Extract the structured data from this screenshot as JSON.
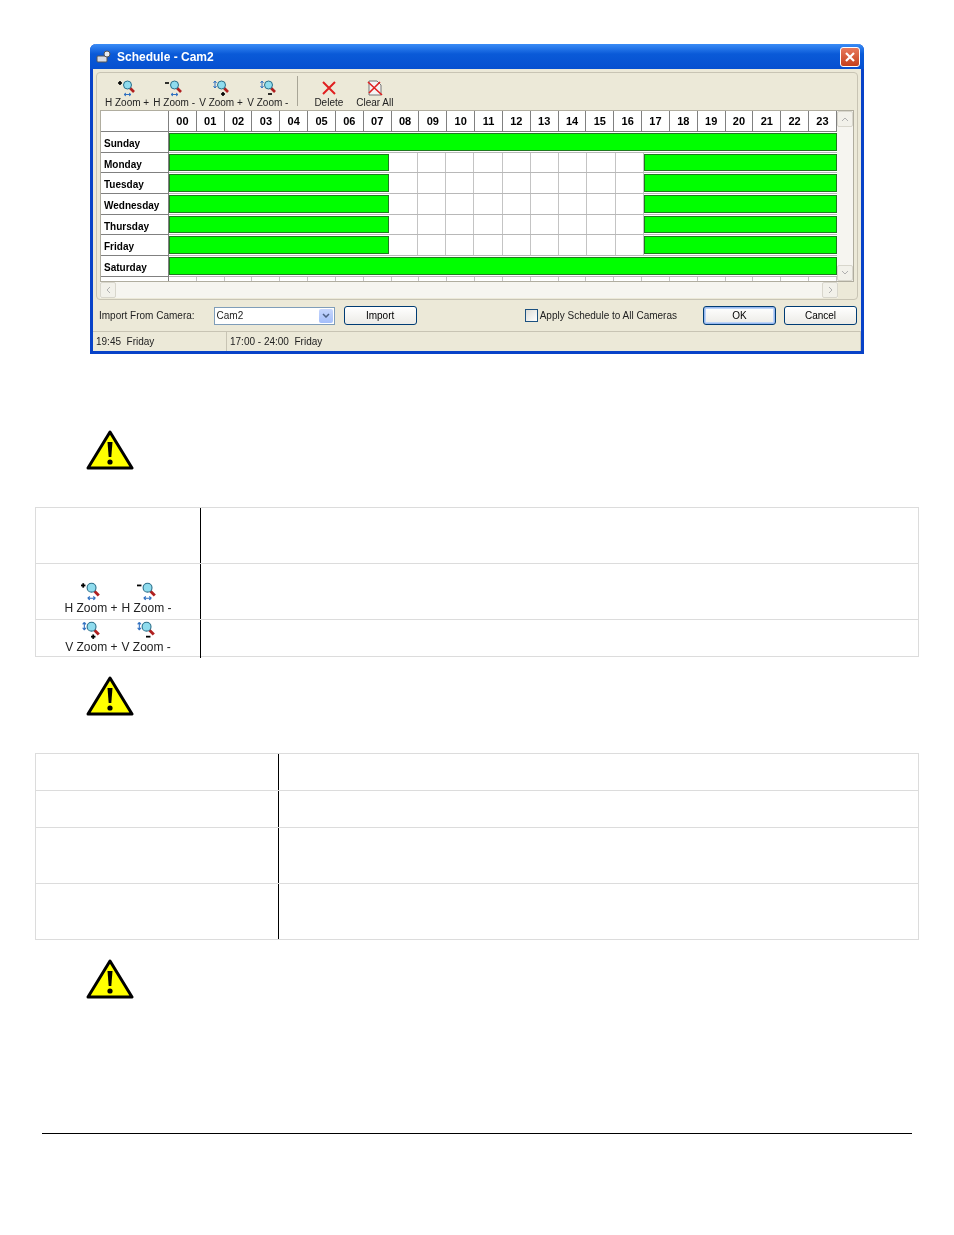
{
  "dialog": {
    "title": "Schedule - Cam2",
    "toolbar": [
      {
        "kind": "hzoom_in",
        "label": "H Zoom +",
        "separator_before": false
      },
      {
        "kind": "hzoom_out",
        "label": "H Zoom -",
        "separator_before": false
      },
      {
        "kind": "vzoom_in",
        "label": "V Zoom +",
        "separator_before": false
      },
      {
        "kind": "vzoom_out",
        "label": "V Zoom -",
        "separator_before": false
      },
      {
        "kind": "delete",
        "label": "Delete",
        "separator_before": true
      },
      {
        "kind": "clear",
        "label": "Clear All",
        "separator_before": false
      }
    ],
    "schedule": {
      "hours": [
        "00",
        "01",
        "02",
        "03",
        "04",
        "05",
        "06",
        "07",
        "08",
        "09",
        "10",
        "11",
        "12",
        "13",
        "14",
        "15",
        "16",
        "17",
        "18",
        "19",
        "20",
        "21",
        "22",
        "23"
      ],
      "days": [
        {
          "name": "Sunday",
          "scheduled": [
            true,
            true,
            true,
            true,
            true,
            true,
            true,
            true,
            true,
            true,
            true,
            true,
            true,
            true,
            true,
            true,
            true,
            true,
            true,
            true,
            true,
            true,
            true,
            true
          ]
        },
        {
          "name": "Monday",
          "scheduled": [
            true,
            true,
            true,
            true,
            true,
            true,
            true,
            true,
            false,
            false,
            false,
            false,
            false,
            false,
            false,
            false,
            false,
            true,
            true,
            true,
            true,
            true,
            true,
            true
          ]
        },
        {
          "name": "Tuesday",
          "scheduled": [
            true,
            true,
            true,
            true,
            true,
            true,
            true,
            true,
            false,
            false,
            false,
            false,
            false,
            false,
            false,
            false,
            false,
            true,
            true,
            true,
            true,
            true,
            true,
            true
          ]
        },
        {
          "name": "Wednesday",
          "scheduled": [
            true,
            true,
            true,
            true,
            true,
            true,
            true,
            true,
            false,
            false,
            false,
            false,
            false,
            false,
            false,
            false,
            false,
            true,
            true,
            true,
            true,
            true,
            true,
            true
          ]
        },
        {
          "name": "Thursday",
          "scheduled": [
            true,
            true,
            true,
            true,
            true,
            true,
            true,
            true,
            false,
            false,
            false,
            false,
            false,
            false,
            false,
            false,
            false,
            true,
            true,
            true,
            true,
            true,
            true,
            true
          ]
        },
        {
          "name": "Friday",
          "scheduled": [
            true,
            true,
            true,
            true,
            true,
            true,
            true,
            true,
            false,
            false,
            false,
            false,
            false,
            false,
            false,
            false,
            false,
            true,
            true,
            true,
            true,
            true,
            true,
            true
          ]
        },
        {
          "name": "Saturday",
          "scheduled": [
            true,
            true,
            true,
            true,
            true,
            true,
            true,
            true,
            true,
            true,
            true,
            true,
            true,
            true,
            true,
            true,
            true,
            true,
            true,
            true,
            true,
            true,
            true,
            true
          ]
        }
      ]
    },
    "import": {
      "label": "Import From Camera:",
      "camera": "Cam2",
      "button": "Import"
    },
    "apply_all": {
      "label": "Apply Schedule to All Cameras",
      "checked": false
    },
    "buttons": [
      {
        "label": "OK",
        "default": true
      },
      {
        "label": "Cancel",
        "default": false
      }
    ],
    "status_bar": [
      "19:45  Friday",
      "17:00 - 24:00  Friday"
    ]
  },
  "sections": [
    {
      "kind": "warning"
    },
    {
      "kind": "table",
      "rows": [
        {
          "tall": true
        },
        {
          "tall": true,
          "items": [
            {
              "kind": "hzoom_in",
              "label": "H Zoom +"
            },
            {
              "kind": "hzoom_out",
              "label": "H Zoom -"
            }
          ]
        },
        {
          "tall": false,
          "items": [
            {
              "kind": "vzoom_in",
              "label": "V Zoom +"
            },
            {
              "kind": "vzoom_out",
              "label": "V Zoom -"
            }
          ]
        }
      ]
    },
    {
      "kind": "warning"
    },
    {
      "kind": "table",
      "rows": [
        {
          "tall": false
        },
        {
          "tall": false
        },
        {
          "tall": true
        },
        {
          "tall": true
        }
      ]
    },
    {
      "kind": "warning"
    }
  ]
}
